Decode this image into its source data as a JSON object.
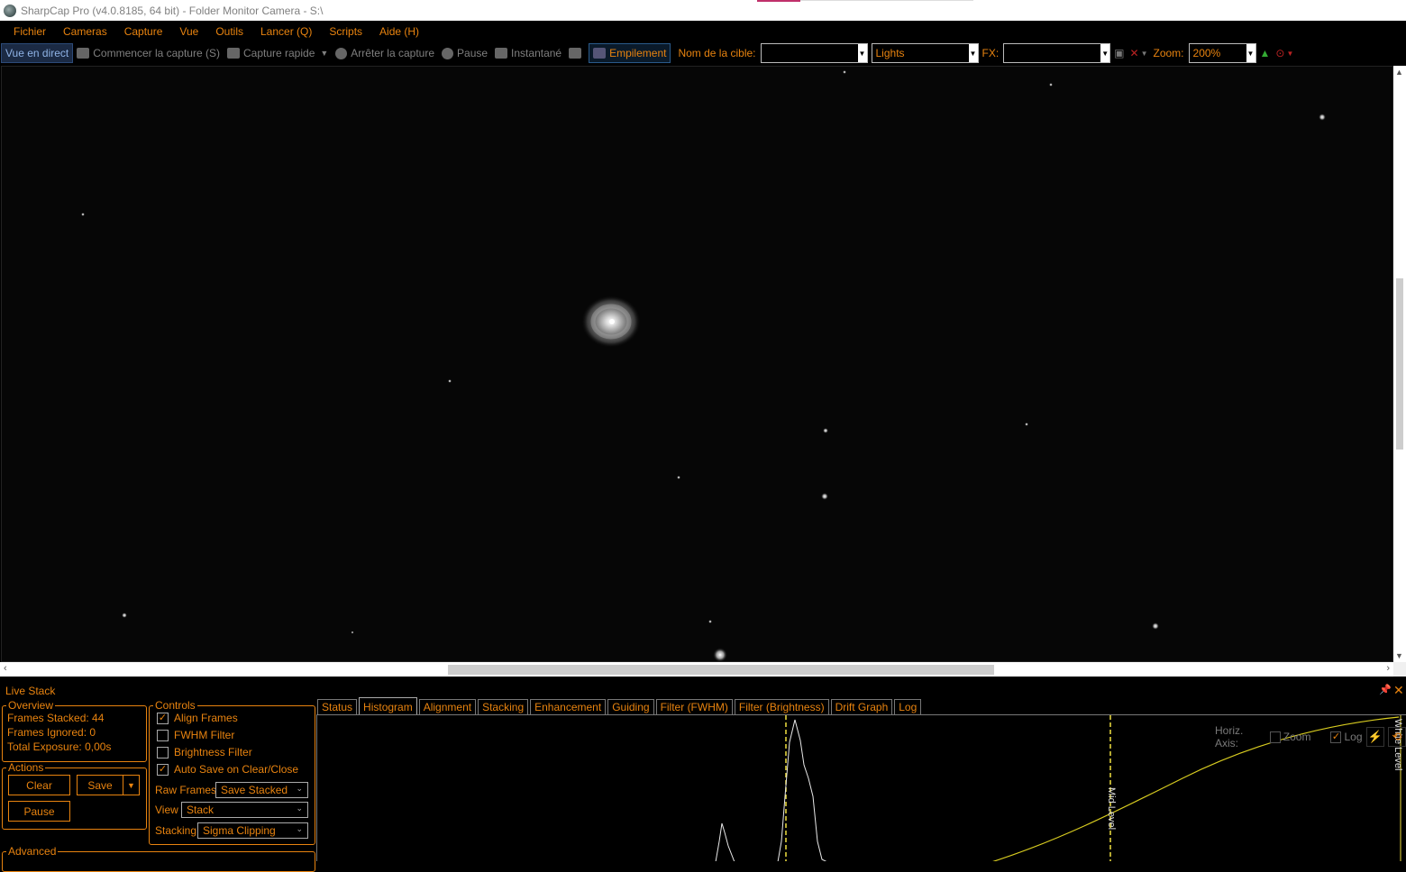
{
  "window": {
    "title": "SharpCap Pro (v4.0.8185, 64 bit) - Folder Monitor Camera - S:\\"
  },
  "menu": [
    "Fichier",
    "Cameras",
    "Capture",
    "Vue",
    "Outils",
    "Lancer (Q)",
    "Scripts",
    "Aide (H)"
  ],
  "toolbar": {
    "live_view": "Vue en direct",
    "start_capture": "Commencer la capture (S)",
    "quick_capture": "Capture rapide",
    "stop_capture": "Arrêter la capture",
    "pause": "Pause",
    "snapshot": "Instantané",
    "stacking": "Empilement",
    "target_label": "Nom de la cible:",
    "target_value": "",
    "frame_type": "Lights",
    "fx_label": "FX:",
    "fx_value": "",
    "zoom_label": "Zoom:",
    "zoom_value": "200%"
  },
  "live_stack": {
    "title": "Live Stack",
    "overview": {
      "legend": "Overview",
      "frames_stacked_label": "Frames Stacked:",
      "frames_stacked": "44",
      "frames_ignored_label": "Frames Ignored:",
      "frames_ignored": "0",
      "total_exposure_label": "Total Exposure:",
      "total_exposure": "0,00s"
    },
    "actions": {
      "legend": "Actions",
      "clear": "Clear",
      "save": "Save",
      "pause": "Pause"
    },
    "advanced_legend": "Advanced",
    "controls": {
      "legend": "Controls",
      "align_frames": "Align Frames",
      "align_frames_checked": true,
      "fwhm_filter": "FWHM Filter",
      "fwhm_filter_checked": false,
      "brightness_filter": "Brightness Filter",
      "brightness_filter_checked": false,
      "auto_save": "Auto Save on Clear/Close",
      "auto_save_checked": true,
      "raw_frames_label": "Raw Frames",
      "raw_frames_value": "Save Stacked",
      "view_label": "View",
      "view_value": "Stack",
      "stacking_label": "Stacking",
      "stacking_value": "Sigma Clipping"
    },
    "tabs": [
      "Status",
      "Histogram",
      "Alignment",
      "Stacking",
      "Enhancement",
      "Guiding",
      "Filter (FWHM)",
      "Filter (Brightness)",
      "Drift Graph",
      "Log"
    ],
    "active_tab": "Histogram",
    "histogram": {
      "horiz_axis_label": "Horiz. Axis:",
      "zoom_label": "Zoom",
      "zoom_checked": false,
      "log_label": "Log",
      "log_checked": true,
      "mid_level_label": "Mid Level",
      "white_level_label": "White Level"
    }
  },
  "colors": {
    "accent": "#e8830f",
    "background": "#000000"
  }
}
